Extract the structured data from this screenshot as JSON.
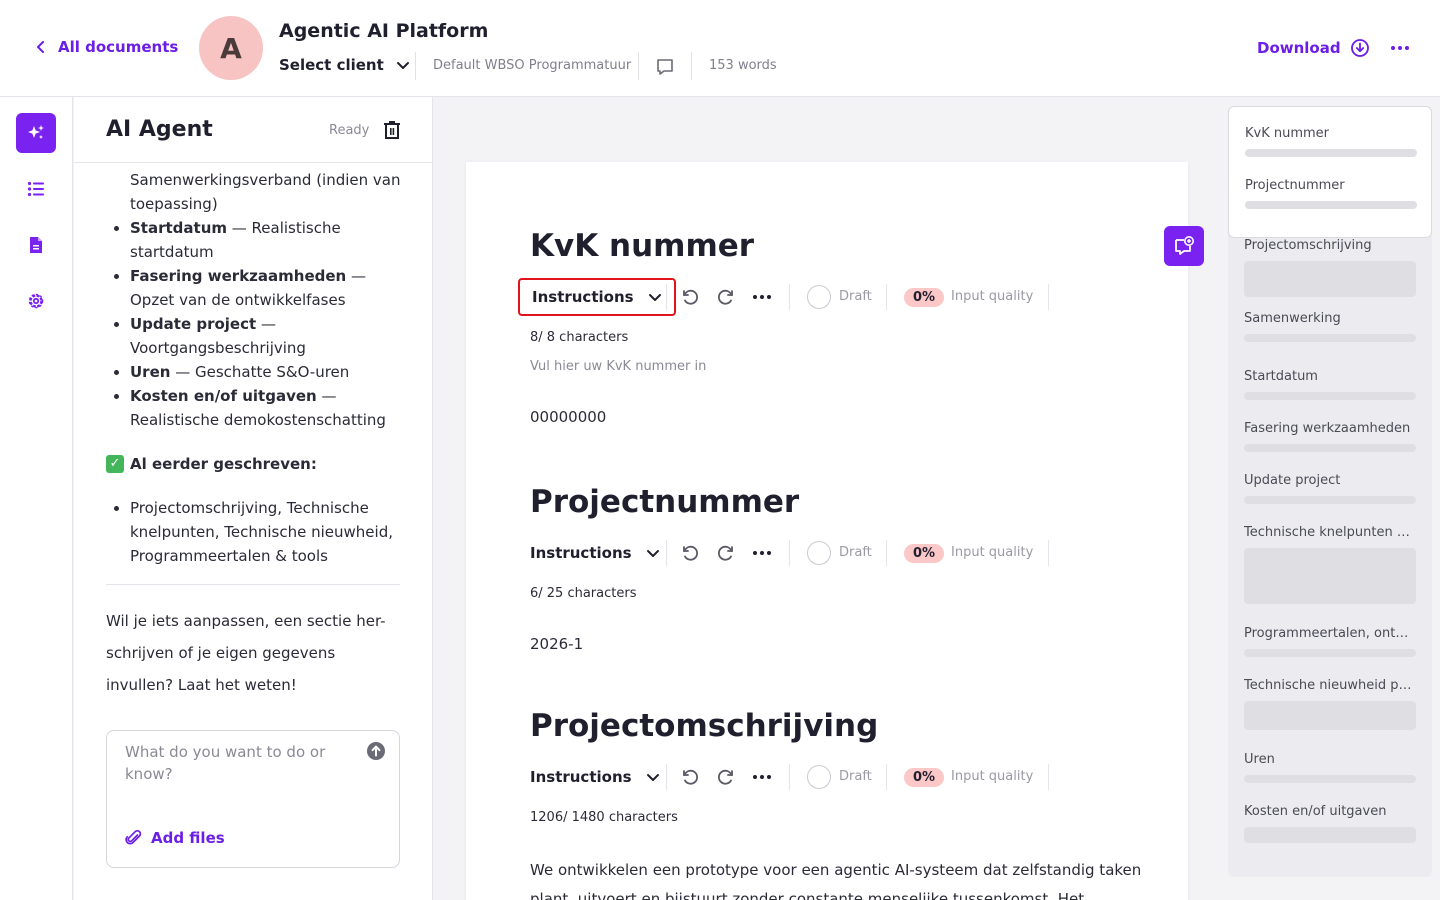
{
  "header": {
    "back_label": "All documents",
    "avatar_initial": "A",
    "title": "Agentic AI Platform",
    "client_label": "Select client",
    "template": "Default WBSO Programmatuur",
    "word_count": "153 words",
    "download_label": "Download"
  },
  "agent": {
    "title": "AI Agent",
    "status": "Ready",
    "items": [
      {
        "bold": "",
        "text": "Samenwerkingsverband (indien van toepassing)",
        "dot": false
      },
      {
        "bold": "Startdatum",
        "text": " — Realistische startdatum",
        "dot": true
      },
      {
        "bold": "Fasering werkzaamheden",
        "text": " — Opzet van de ontwikkelfases",
        "dot": true
      },
      {
        "bold": "Update project",
        "text": " — Voortgangsbeschrijving",
        "dot": true
      },
      {
        "bold": "Uren",
        "text": " — Geschatte S&O-uren",
        "dot": true
      },
      {
        "bold": "Kosten en/of uitgaven",
        "text": " — Realistische demokostenschatting",
        "dot": true
      }
    ],
    "written_heading": "Al eerder geschreven:",
    "written_items": [
      "Projectomschrijving, Technische knelpunten, Technische nieuwheid, Programmeertalen & tools"
    ],
    "message": "Wil je iets aanpassen, een sectie her-schrijven of je eigen gegevens invullen? Laat het weten!",
    "input_placeholder": "What do you want to do or know?",
    "add_files_label": "Add files"
  },
  "document": {
    "instructions_label": "Instructions",
    "draft_label": "Draft",
    "quality_pct": "0%",
    "quality_label": "Input quality",
    "sections": [
      {
        "title": "KvK nummer",
        "chars": "8/ 8 characters",
        "hint": "Vul hier uw KvK nummer in",
        "value": "00000000"
      },
      {
        "title": "Projectnummer",
        "chars": "6/ 25 characters",
        "value": "2026-1"
      },
      {
        "title": "Projectomschrijving",
        "chars": "1206/ 1480 characters",
        "value": "We ontwikkelen een prototype voor een agentic AI-systeem dat zelfstandig taken plant, uitvoert en bijstuurt zonder constante menselijke tussenkomst. Het"
      }
    ]
  },
  "outline": {
    "items": [
      "KvK nummer",
      "Projectnummer",
      "Projectomschrijving",
      "Samenwerking",
      "Startdatum",
      "Fasering werkzaamheden",
      "Update project",
      "Technische knelpunten en oplossingen",
      "Programmeertalen, ontwikkeltools",
      "Technische nieuwheid project",
      "Uren",
      "Kosten en/of uitgaven"
    ]
  },
  "colors": {
    "accent": "#6b1ee6",
    "accent_bg": "#7a22f0",
    "highlight_border": "#e0141a",
    "quality_badge": "#fcc7c7",
    "avatar_bg": "#f7c3c3"
  }
}
